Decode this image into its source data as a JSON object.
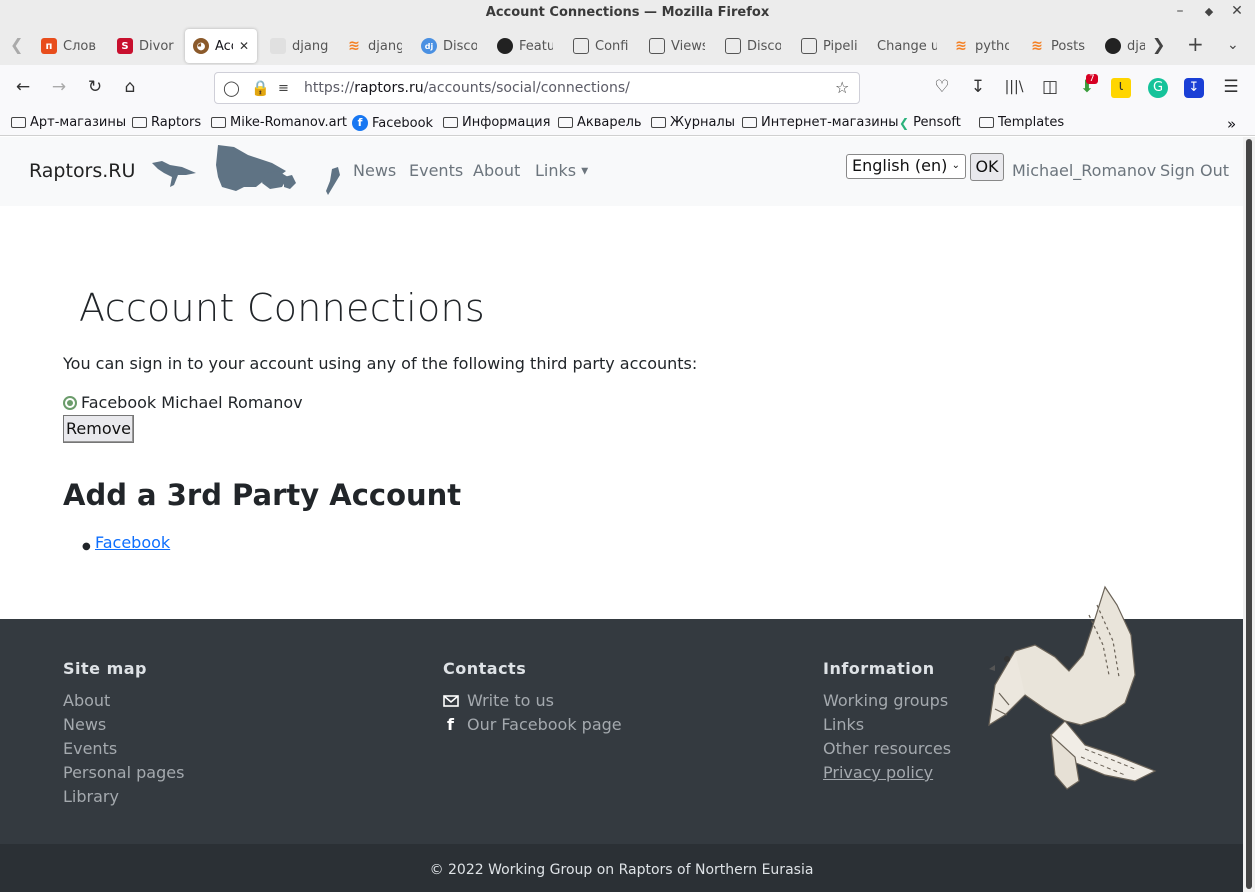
{
  "window": {
    "title": "Account Connections — Mozilla Firefox"
  },
  "tabs": [
    {
      "label": "Слов",
      "icon": "pinterest-icon",
      "color": "#e84d1c"
    },
    {
      "label": "Divor",
      "icon": "scribd-icon",
      "color": "#c8102e"
    },
    {
      "label": "Acc",
      "icon": "owl-icon",
      "color": "#8b5a2b",
      "active": true
    },
    {
      "label": "djang",
      "icon": "cube-icon",
      "color": "#cfcfcf"
    },
    {
      "label": "djang",
      "icon": "stackoverflow-icon",
      "color": "#f48024"
    },
    {
      "label": "Disco",
      "icon": "django-icon",
      "color": "#4a90e2"
    },
    {
      "label": "Featu",
      "icon": "github-icon",
      "color": "#222222"
    },
    {
      "label": "Confi",
      "icon": "book-icon",
      "color": "#555555"
    },
    {
      "label": "Views",
      "icon": "book-icon",
      "color": "#555555"
    },
    {
      "label": "Disco",
      "icon": "book-icon",
      "color": "#555555"
    },
    {
      "label": "Pipeli",
      "icon": "book-icon",
      "color": "#555555"
    },
    {
      "label": "Change u",
      "icon": "",
      "color": ""
    },
    {
      "label": "pytho",
      "icon": "stackoverflow-icon",
      "color": "#f48024"
    },
    {
      "label": "Posts",
      "icon": "stackoverflow-icon",
      "color": "#f48024"
    },
    {
      "label": "dja",
      "icon": "github-icon",
      "color": "#222222"
    }
  ],
  "urlbar": {
    "prefix": "https://",
    "domain": "raptors.ru",
    "path": "/accounts/social/connections/"
  },
  "bookmarks": [
    {
      "label": "Арт-магазины",
      "icon": "folder-icon"
    },
    {
      "label": "Raptors",
      "icon": "folder-icon"
    },
    {
      "label": "Mike-Romanov.art",
      "icon": "folder-icon"
    },
    {
      "label": "Facebook",
      "icon": "facebook-icon"
    },
    {
      "label": "Информация",
      "icon": "folder-icon"
    },
    {
      "label": "Акварель",
      "icon": "folder-icon"
    },
    {
      "label": "Журналы",
      "icon": "folder-icon"
    },
    {
      "label": "Интернет-магазины",
      "icon": "folder-icon"
    },
    {
      "label": "Pensoft",
      "icon": "pensoft-icon"
    },
    {
      "label": "Templates",
      "icon": "folder-icon"
    }
  ],
  "extension_badge": "7",
  "site": {
    "brand": "Raptors.RU",
    "nav": [
      "News",
      "Events",
      "About",
      "Links"
    ],
    "language": "English (en)",
    "ok": "OK",
    "username": "Michael_Romanov",
    "sign_out": "Sign Out"
  },
  "content": {
    "title": "Account Connections",
    "intro": "You can sign in to your account using any of the following third party accounts:",
    "connected_account": "Facebook Michael Romanov",
    "remove": "Remove",
    "add_title": "Add a 3rd Party Account",
    "providers": [
      "Facebook"
    ]
  },
  "footer": {
    "sitemap_title": "Site map",
    "sitemap": [
      "About",
      "News",
      "Events",
      "Personal pages",
      "Library"
    ],
    "contacts_title": "Contacts",
    "contacts": [
      {
        "label": "Write to us",
        "icon": "envelope-icon"
      },
      {
        "label": "Our Facebook page",
        "icon": "facebook-f-icon"
      }
    ],
    "info_title": "Information",
    "info": [
      "Working groups",
      "Links",
      "Other resources",
      "Privacy policy"
    ],
    "copyright": "© 2022 Working Group on Raptors of Northern Eurasia"
  }
}
